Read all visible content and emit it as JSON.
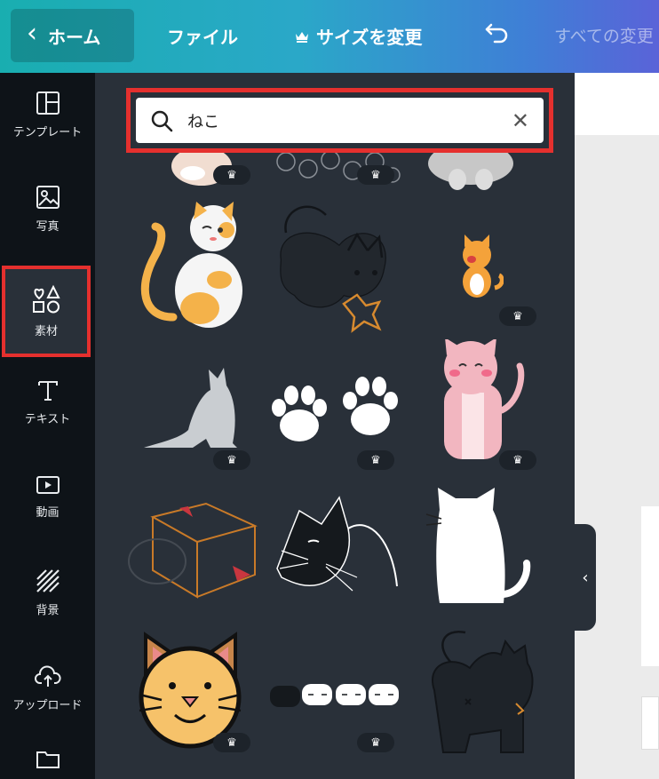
{
  "topbar": {
    "home_label": "ホーム",
    "file_label": "ファイル",
    "resize_label": "サイズを変更",
    "saved_label": "すべての変更"
  },
  "rail": {
    "items": [
      {
        "label": "テンプレート"
      },
      {
        "label": "写真"
      },
      {
        "label": "素材"
      },
      {
        "label": "テキスト"
      },
      {
        "label": "動画"
      },
      {
        "label": "背景"
      },
      {
        "label": "アップロード"
      }
    ]
  },
  "search": {
    "value": "ねこ"
  },
  "colors": {
    "highlight": "#e5302e",
    "panel_bg": "#293039",
    "rail_bg": "#0e1318"
  }
}
